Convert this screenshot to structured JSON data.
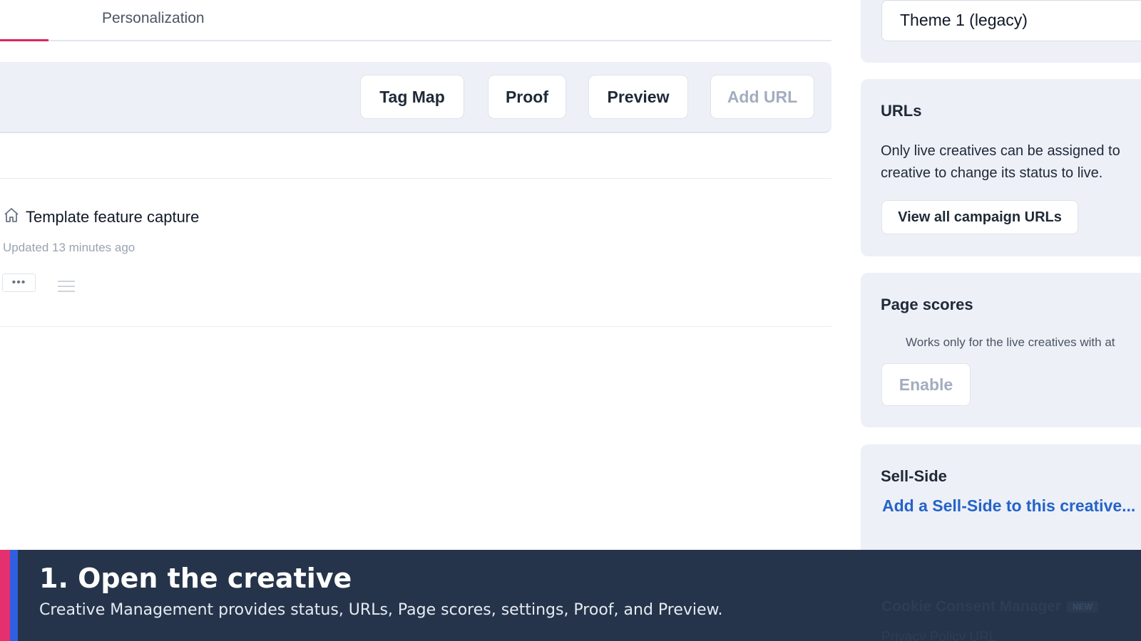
{
  "tabs": {
    "active_label": "Personalization"
  },
  "toolbar": {
    "buttons": [
      {
        "label": "Tag Map",
        "disabled": false
      },
      {
        "label": "Proof",
        "disabled": false
      },
      {
        "label": "Preview",
        "disabled": false
      },
      {
        "label": "Add URL",
        "disabled": true
      }
    ]
  },
  "creative": {
    "name": "Template feature capture",
    "updated": "Updated 13 minutes ago",
    "more_label": "•••"
  },
  "sidebar": {
    "theme_value": "Theme 1 (legacy)",
    "urls": {
      "title": "URLs",
      "text_line1": "Only live creatives can be assigned to",
      "text_line2": "creative to change its status to live.",
      "button": "View all campaign URLs"
    },
    "page_scores": {
      "title": "Page scores",
      "note": "Works only for the live creatives with at",
      "button": "Enable"
    },
    "sell_side": {
      "title": "Sell-Side",
      "link": "Add a Sell-Side to this creative..."
    },
    "cookie_consent": {
      "title": "Cookie Consent Manager",
      "badge": "NEW",
      "text": "Privacy Policy URL"
    }
  },
  "tutorial": {
    "title": "1. Open the creative",
    "text": "Creative Management provides status, URLs, Page scores, settings, Proof, and Preview."
  },
  "colors": {
    "accent_pink": "#e0245e",
    "accent_blue": "#2f5fe0",
    "link_blue": "#2563c9",
    "overlay_bg": "#1e2d44",
    "panel_bg": "#edf0f7"
  }
}
